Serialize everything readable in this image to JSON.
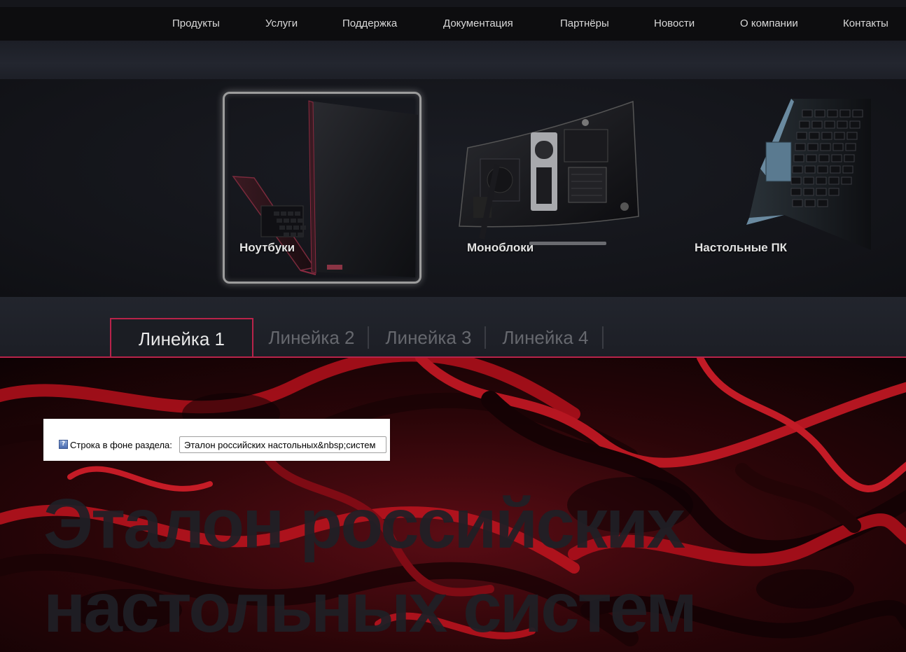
{
  "nav": {
    "items": [
      "Продукты",
      "Услуги",
      "Поддержка",
      "Документация",
      "Партнёры",
      "Новости",
      "О компании",
      "Контакты"
    ]
  },
  "categories": [
    {
      "label": "Ноутбуки",
      "icon": "laptop-image",
      "selected": true
    },
    {
      "label": "Моноблоки",
      "icon": "all-in-one-pc-image",
      "selected": false
    },
    {
      "label": "Настольные ПК",
      "icon": "desktop-pc-image",
      "selected": false
    }
  ],
  "tabs": [
    {
      "label": "Линейка 1",
      "active": true
    },
    {
      "label": "Линейка 2",
      "active": false
    },
    {
      "label": "Линейка 3",
      "active": false
    },
    {
      "label": "Линейка 4",
      "active": false
    }
  ],
  "editor": {
    "help_icon": "?",
    "label": "Строка в фоне раздела:",
    "value": "Эталон российских настольных&nbsp;систем"
  },
  "hero": {
    "line1": "Эталон российских",
    "line2": "настольных систем"
  },
  "colors": {
    "accent": "#b8234a",
    "nav_bg": "#0d0d0f",
    "text_light": "#e3e3e3",
    "tab_inactive": "#66686e"
  }
}
